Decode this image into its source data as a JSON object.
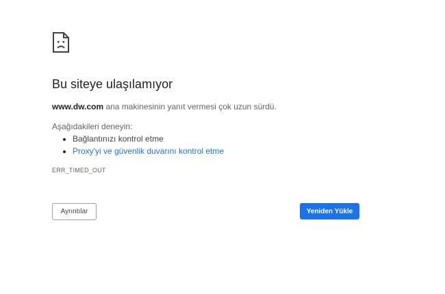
{
  "error_page": {
    "icon": "sad-page-icon",
    "title": "Bu siteye ulaşılamıyor",
    "summary": {
      "host": "www.dw.com",
      "message": " ana makinesinin yanıt vermesi çok uzun sürdü."
    },
    "suggestions_heading": "Aşağıdakileri deneyin:",
    "suggestions": [
      {
        "text": "Bağlantınızı kontrol etme",
        "is_link": false
      },
      {
        "text": "Proxy'yi ve güvenlik duvarını kontrol etme",
        "is_link": true
      }
    ],
    "error_code": "ERR_TIMED_OUT"
  },
  "buttons": {
    "details_label": "Ayrıntılar",
    "reload_label": "Yeniden Yükle"
  },
  "colors": {
    "accent": "#1a73e8",
    "text_primary": "#202124",
    "text_secondary": "#5f6368"
  }
}
